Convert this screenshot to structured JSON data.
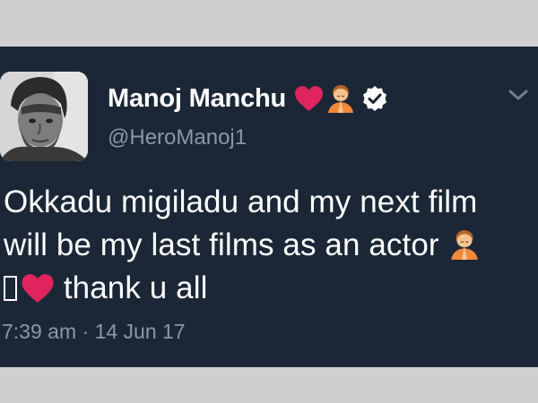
{
  "tweet": {
    "display_name": "Manoj Manchu",
    "handle": "@HeroManoj1",
    "text_line1": "Okkadu migiladu and my next film",
    "text_line2": "will be my last films as an actor",
    "text_line3": "thank u all",
    "time": "7:39 am",
    "separator": "·",
    "date": "14 Jun 17"
  },
  "icons": {
    "name_emoji_1": "red-heart-icon",
    "name_emoji_2": "praying-person-icon",
    "badge": "verified-badge-icon",
    "menu": "chevron-down-icon",
    "text_emoji_1": "praying-person-icon",
    "text_emoji_2": "missing-glyph-box",
    "text_emoji_3": "red-heart-icon"
  },
  "colors": {
    "card_background": "#1b2736",
    "frame_background": "#cfcfcf",
    "primary_text": "#ffffff",
    "secondary_text": "#8899a6",
    "heart": "#e0245e"
  }
}
